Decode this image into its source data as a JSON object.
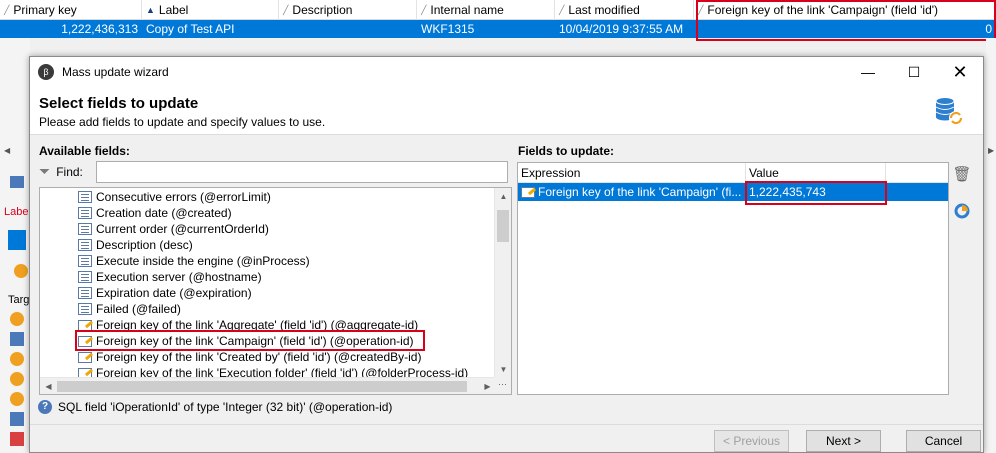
{
  "grid": {
    "columns": [
      "Primary key",
      "Label",
      "Description",
      "Internal name",
      "Last modified",
      "Foreign key of the link 'Campaign' (field 'id')"
    ],
    "row": {
      "primary_key": "1,222,436,313",
      "label": "Copy of Test API",
      "description": "",
      "internal_name": "WKF1315",
      "last_modified": "10/04/2019 9:37:55 AM",
      "campaign_fk": "0"
    },
    "side_text": "Labe",
    "side_text2": "Targ"
  },
  "dialog": {
    "title": "Mass update wizard",
    "heading": "Select fields to update",
    "subheading": "Please add fields to update and specify values to use.",
    "available_label": "Available fields:",
    "find_label": "Find:",
    "find_value": "",
    "fields": [
      "Consecutive errors (@errorLimit)",
      "Creation date (@created)",
      "Current order (@currentOrderId)",
      "Description (desc)",
      "Execute inside the engine (@inProcess)",
      "Execution server (@hostname)",
      "Expiration date (@expiration)",
      "Failed (@failed)",
      "Foreign key of the link 'Aggregate' (field 'id') (@aggregate-id)",
      "Foreign key of the link 'Campaign' (field 'id') (@operation-id)",
      "Foreign key of the link 'Created by' (field 'id') (@createdBy-id)",
      "Foreign key of the link 'Execution folder' (field 'id') (@folderProcess-id)"
    ],
    "update_label": "Fields to update:",
    "update_columns": [
      "Expression",
      "Value"
    ],
    "update_row": {
      "expression": "Foreign key of the link 'Campaign' (fi...",
      "value": "1,222,435,743"
    },
    "hint": "SQL field 'iOperationId' of type 'Integer (32 bit)' (@operation-id)",
    "buttons": {
      "previous": "< Previous",
      "next": "Next >",
      "cancel": "Cancel"
    }
  }
}
